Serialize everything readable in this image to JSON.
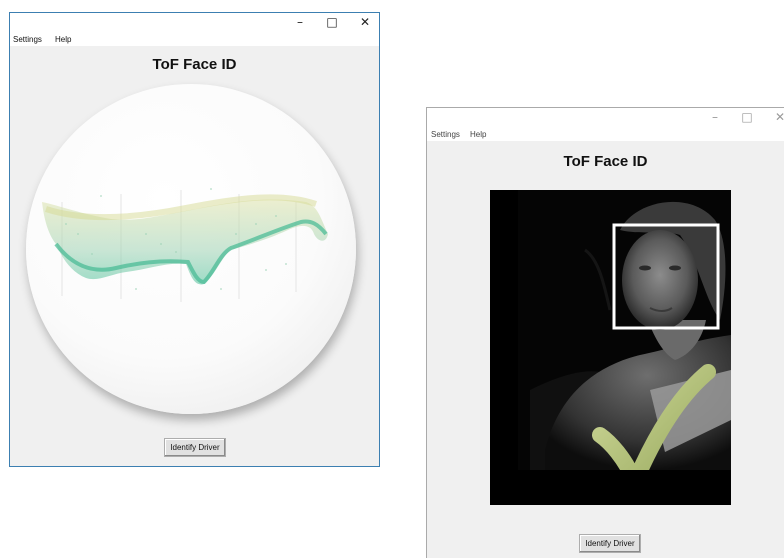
{
  "window_controls": {
    "minimize": "–",
    "maximize": "□",
    "close": "✕"
  },
  "left_window": {
    "menu": [
      "Settings",
      "Help"
    ],
    "title": "ToF Face ID",
    "button_label": "Identify Driver"
  },
  "right_window": {
    "menu": [
      "Settings",
      "Help"
    ],
    "title": "ToF Face ID",
    "button_label": "Identify Driver"
  },
  "colors": {
    "window_bg": "#f0f0f0",
    "window_border_active": "#3c7fb1",
    "face_box": "#ffffff",
    "checkmark": "#b5c47c",
    "point_cloud_teal": "#5cc7a3",
    "point_cloud_yellow": "#d9df9e"
  }
}
